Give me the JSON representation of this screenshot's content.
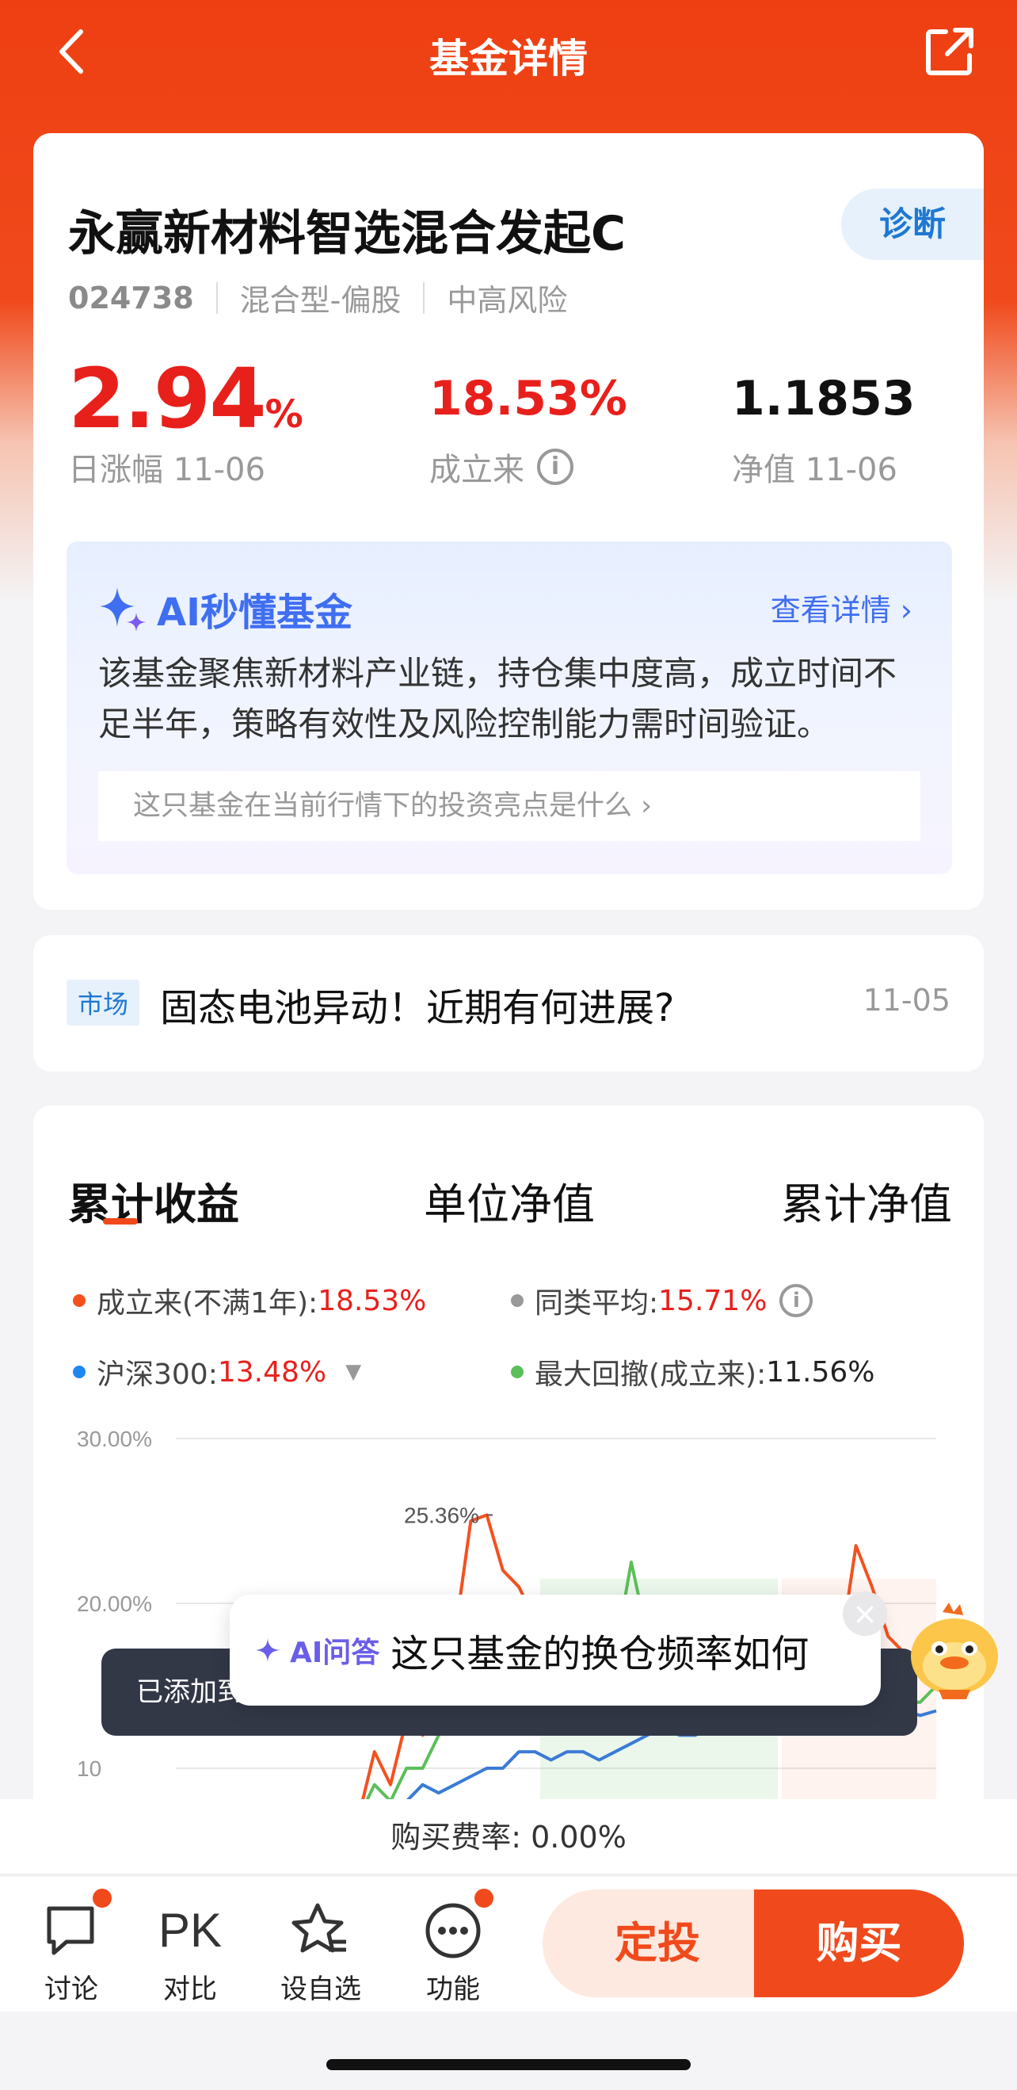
{
  "nav": {
    "title": "基金详情"
  },
  "fund": {
    "name": "永赢新材料智选混合发起C",
    "diagnose": "诊断",
    "code": "024738",
    "type": "混合型-偏股",
    "risk": "中高风险",
    "day_change": "2.94",
    "day_change_unit": "%",
    "day_change_label": "日涨幅 11-06",
    "since_inception": "18.53%",
    "since_inception_label": "成立来",
    "nav": "1.1853",
    "nav_label": "净值 11-06"
  },
  "ai": {
    "title": "AI秒懂基金",
    "more": "查看详情",
    "summary": "该基金聚焦新材料产业链，持仓集中度高，成立时间不足半年，策略有效性及风险控制能力需时间验证。",
    "question": "这只基金在当前行情下的投资亮点是什么"
  },
  "news": {
    "tag": "市场",
    "title": "固态电池异动！近期有何进展?",
    "date": "11-05"
  },
  "tabs": [
    "累计收益",
    "单位净值",
    "累计净值"
  ],
  "legend": {
    "fund_label": "成立来(不满1年):",
    "fund_value": "18.53%",
    "peer_label": "同类平均:",
    "peer_value": "15.71%",
    "index_label": "沪深300:",
    "index_value": "13.48%",
    "drawdown_label": "最大回撤(成立来):",
    "drawdown_value": "11.56%"
  },
  "chart_data": {
    "type": "line",
    "y_ticks": [
      "30.00%",
      "20.00%",
      "10"
    ],
    "peak_label": "25.36%",
    "ylim": [
      5,
      30
    ],
    "series": [
      {
        "name": "成立来(不满1年)",
        "color": "#f4511e",
        "values": [
          6,
          8,
          7,
          11,
          9,
          13,
          12,
          16,
          18,
          25,
          25.36,
          22,
          21,
          19,
          18,
          19,
          17,
          16,
          15,
          16,
          17,
          18,
          20,
          19,
          17,
          18,
          16,
          15,
          14,
          16,
          17,
          18,
          17,
          23.5,
          21,
          18,
          17,
          16,
          18.5
        ]
      },
      {
        "name": "同类平均",
        "color": "#5bbf5a",
        "values": [
          6,
          7,
          7,
          9,
          8,
          10,
          10,
          12,
          13,
          17,
          18,
          20,
          19,
          18,
          17,
          18,
          20,
          18.5,
          17,
          22.5,
          18,
          17,
          16,
          15,
          15,
          15,
          14,
          14,
          13,
          14,
          14,
          15,
          14,
          15,
          15,
          14,
          14,
          14,
          15
        ]
      },
      {
        "name": "沪深300",
        "color": "#3a7bd5",
        "values": [
          6,
          6.5,
          7,
          7.5,
          8,
          8,
          9,
          8.5,
          9,
          9.5,
          10,
          10,
          11,
          11,
          10.5,
          11,
          11,
          10.5,
          11,
          11.5,
          12,
          12.5,
          12,
          12,
          12.5,
          13,
          12.5,
          13,
          13,
          13,
          13.5,
          13,
          13.5,
          13,
          13.5,
          13.5,
          13.5,
          13.2,
          13.48
        ]
      }
    ]
  },
  "toast": {
    "text": "已添加到"
  },
  "ai_ask": {
    "tag": "AI问答",
    "text": "这只基金的换仓频率如何"
  },
  "fee": {
    "label": "购买费率:",
    "value": "0.00%"
  },
  "bottom": {
    "discuss": "讨论",
    "pk": "PK",
    "compare": "对比",
    "watch": "设自选",
    "func": "功能",
    "dingtou": "定投",
    "buy": "购买"
  },
  "colors": {
    "brand": "#f04a1c",
    "up": "#e8201c",
    "ai_blue": "#3f6ef0"
  }
}
